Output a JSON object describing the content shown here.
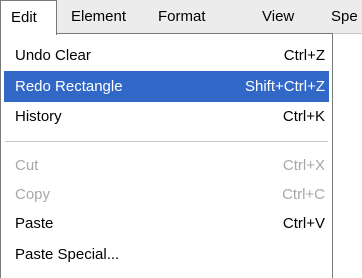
{
  "menubar": {
    "items": [
      {
        "label": "Edit",
        "active": true
      },
      {
        "label": "Element"
      },
      {
        "label": "Format"
      },
      {
        "label": "View"
      },
      {
        "label": "Spe"
      }
    ]
  },
  "edit_menu": {
    "items": [
      {
        "label": "Undo Clear",
        "shortcut": "Ctrl+Z",
        "enabled": true
      },
      {
        "label": "Redo Rectangle",
        "shortcut": "Shift+Ctrl+Z",
        "enabled": true,
        "highlighted": true
      },
      {
        "label": "History",
        "shortcut": "Ctrl+K",
        "enabled": true
      },
      {
        "label": "Cut",
        "shortcut": "Ctrl+X",
        "enabled": false
      },
      {
        "label": "Copy",
        "shortcut": "Ctrl+C",
        "enabled": false
      },
      {
        "label": "Paste",
        "shortcut": "Ctrl+V",
        "enabled": true
      },
      {
        "label": "Paste Special...",
        "enabled": true
      }
    ]
  },
  "colors": {
    "highlight": "#3168c8",
    "disabled_text": "#a8a8a8",
    "menubar_bg": "#ececec"
  }
}
